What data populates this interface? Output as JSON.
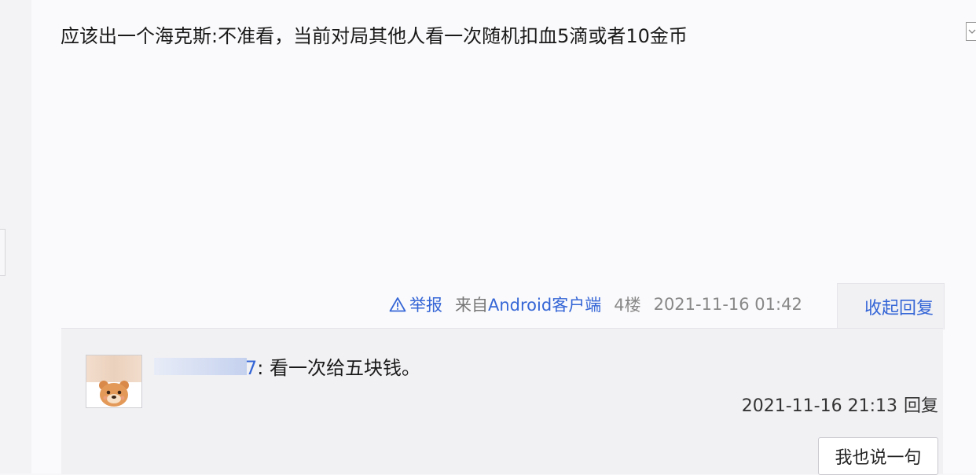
{
  "post": {
    "content": "应该出一个海克斯:不准看，当前对局其他人看一次随机扣血5滴或者10金币",
    "report_label": "举报",
    "source_prefix": "来自",
    "source_client": "Android客户端",
    "floor": "4楼",
    "time": "2021-11-16 01:42",
    "collapse_label": "收起回复"
  },
  "reply": {
    "username_tail": "7",
    "separator": ": ",
    "content": "看一次给五块钱。",
    "time": "2021-11-16 21:13",
    "reply_label": "回复"
  },
  "composer": {
    "button_label": "我也说一句"
  },
  "colors": {
    "link": "#3566d6",
    "background": "#fafafc",
    "reply_panel": "#f1f1f4"
  },
  "icons": {
    "report": "warning-triangle-icon",
    "corner": "chevron-down-icon",
    "avatar": "bear-avatar"
  }
}
